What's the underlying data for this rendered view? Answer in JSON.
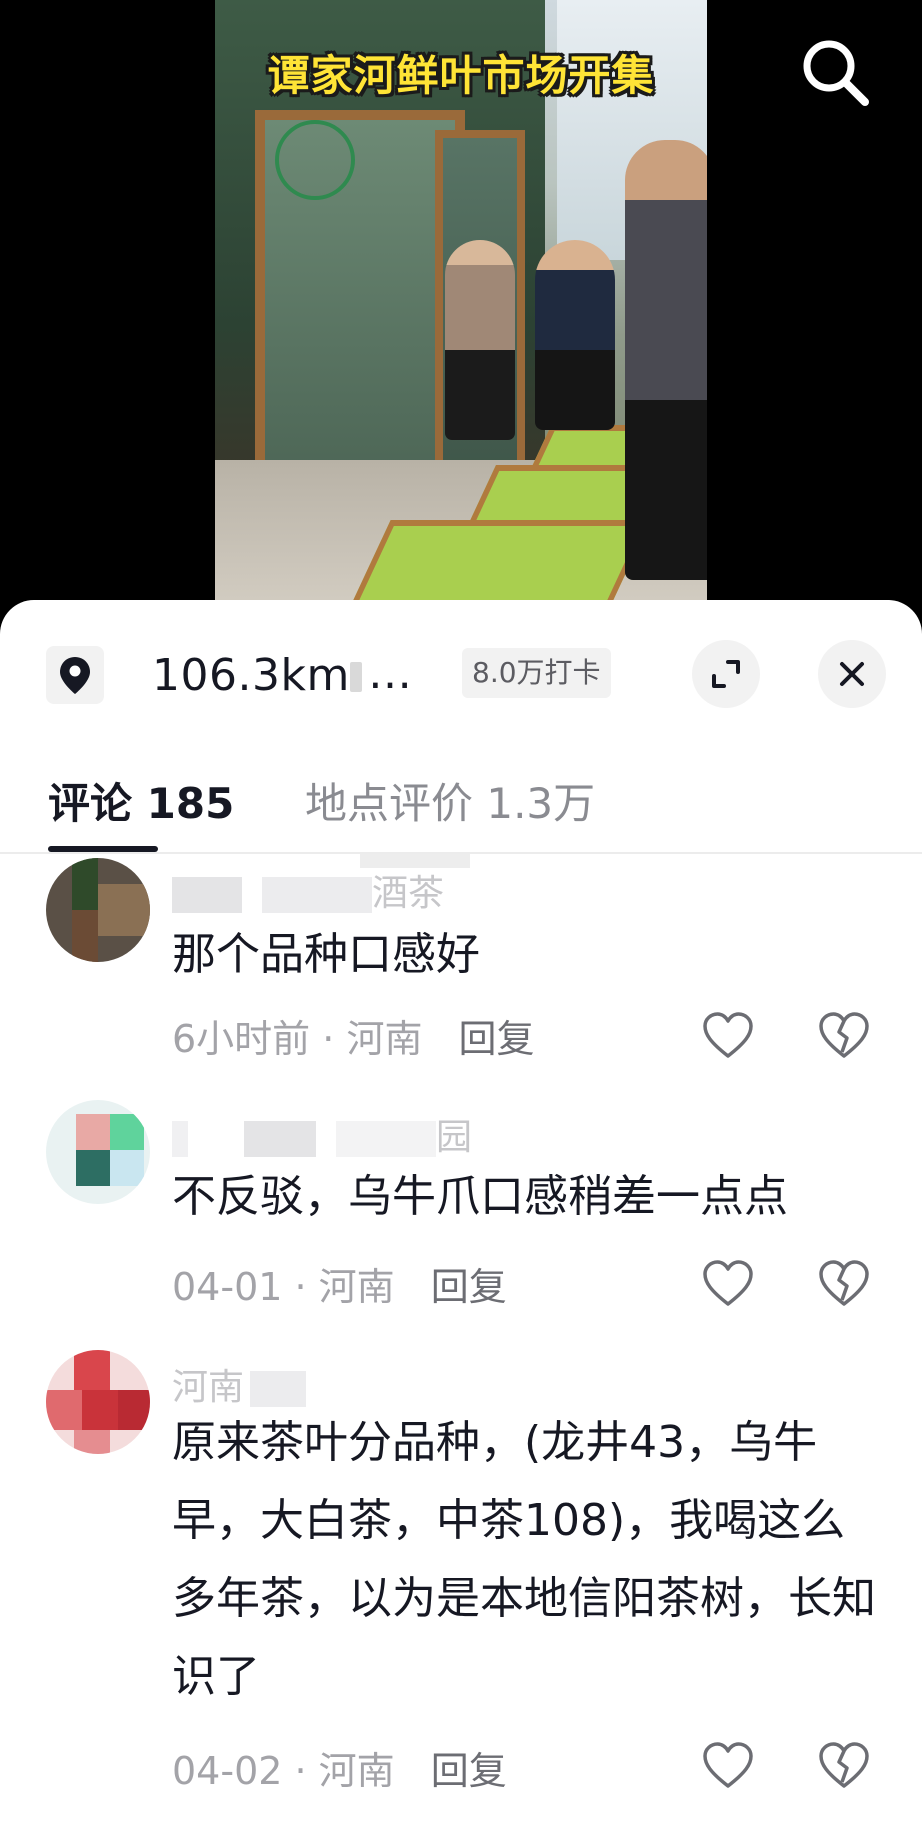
{
  "video": {
    "title": "谭家河鲜叶市场开集"
  },
  "location_bar": {
    "distance": "106.3km",
    "ellipsis": "…",
    "checkin": "8.0万打卡"
  },
  "tabs": [
    {
      "label": "评论 185",
      "active": true
    },
    {
      "label": "地点评价 1.3万",
      "active": false
    }
  ],
  "comments": [
    {
      "username_visible": "酒茶",
      "text": "那个品种口感好",
      "time": "6小时前",
      "region": "河南",
      "reply_label": "回复"
    },
    {
      "username_visible": "园",
      "text": "不反驳，乌牛爪口感稍差一点点",
      "time": "04-01",
      "region": "河南",
      "reply_label": "回复"
    },
    {
      "username_visible": "河南",
      "text": "原来茶叶分品种，(龙井43，乌牛早，大白茶，中茶108)，我喝这么多年茶，以为是本地信阳茶树，长知识了",
      "time": "04-02",
      "region": "河南",
      "reply_label": "回复"
    }
  ],
  "meta_separator": " · ",
  "colors": {
    "title_yellow": "#ffe436",
    "text_primary": "#161823",
    "text_secondary": "#a3a3a8",
    "sheet_bg": "#ffffff"
  },
  "icons": {
    "search": "search-icon",
    "location": "location-pin-icon",
    "expand": "expand-icon",
    "close": "close-icon",
    "like": "heart-icon",
    "dislike": "broken-heart-icon"
  }
}
